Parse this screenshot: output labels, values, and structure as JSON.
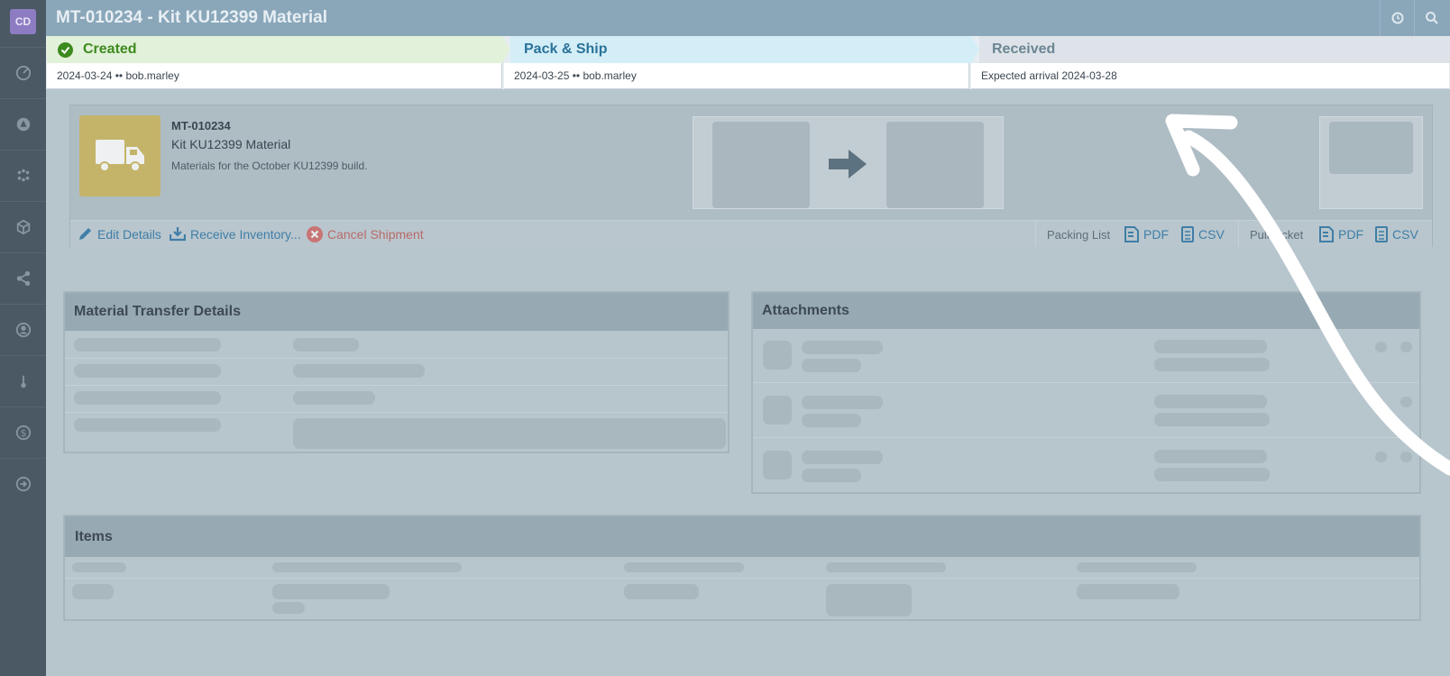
{
  "app": {
    "avatar_initials": "CD",
    "title": "MT-010234 - Kit KU12399 Material"
  },
  "nav_icons": [
    "dashboard-icon",
    "alert-triangle-icon",
    "modules-icon",
    "box-icon",
    "share-icon",
    "user-circle-icon",
    "thermometer-icon",
    "dollar-icon",
    "logout-icon"
  ],
  "steps": [
    {
      "label": "Created",
      "detail": "2024-03-24 •• bob.marley",
      "state": "done"
    },
    {
      "label": "Pack & Ship",
      "detail": "2024-03-25 •• bob.marley",
      "state": "current"
    },
    {
      "label": "Received",
      "detail": "Expected arrival 2024-03-28",
      "state": "pending"
    }
  ],
  "transfer": {
    "id": "MT-010234",
    "name": "Kit KU12399 Material",
    "description": "Materials for the October KU12399 build."
  },
  "actions": {
    "edit": "Edit Details",
    "receive": "Receive Inventory...",
    "cancel": "Cancel Shipment",
    "packing_list": "Packing List",
    "pull_ticket": "Pull Ticket",
    "pdf": "PDF",
    "csv": "CSV"
  },
  "panels": {
    "details_title": "Material Transfer Details",
    "attachments_title": "Attachments",
    "items_title": "Items"
  },
  "colors": {
    "created_bg": "#e2f1d9",
    "created_text": "#3d8a1f",
    "pack_bg": "#d4eef7",
    "pack_text": "#2a7399",
    "received_bg": "#dde3e8",
    "received_text": "#6c8593"
  }
}
